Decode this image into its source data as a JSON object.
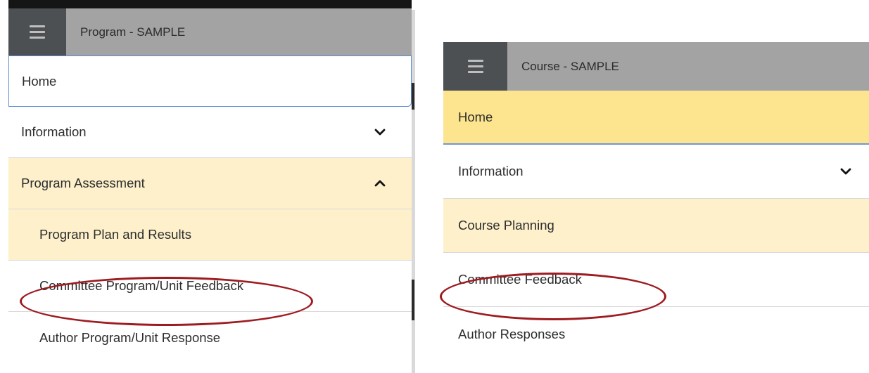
{
  "left_panel": {
    "title": "Program - SAMPLE",
    "menu_icon": "hamburger-icon",
    "items": [
      {
        "label": "Home"
      },
      {
        "label": "Information",
        "icon": "chevron-down-icon"
      },
      {
        "label": "Program Assessment",
        "icon": "chevron-up-icon"
      },
      {
        "label": "Program Plan and Results"
      },
      {
        "label": "Committee Program/Unit Feedback"
      },
      {
        "label": "Author Program/Unit Response"
      }
    ]
  },
  "right_panel": {
    "title": "Course - SAMPLE",
    "menu_icon": "hamburger-icon",
    "items": [
      {
        "label": "Home"
      },
      {
        "label": "Information",
        "icon": "chevron-down-icon"
      },
      {
        "label": "Course Planning"
      },
      {
        "label": "Committee Feedback"
      },
      {
        "label": "Author Responses"
      }
    ]
  },
  "colors": {
    "header_bg": "#a3a3a3",
    "menu_button_bg": "#4d5053",
    "highlight_yellow": "#fde48e",
    "section_yellow": "#fdf0cb",
    "annotation_red": "#9e1b20",
    "active_border_blue": "#5b8dd6"
  }
}
